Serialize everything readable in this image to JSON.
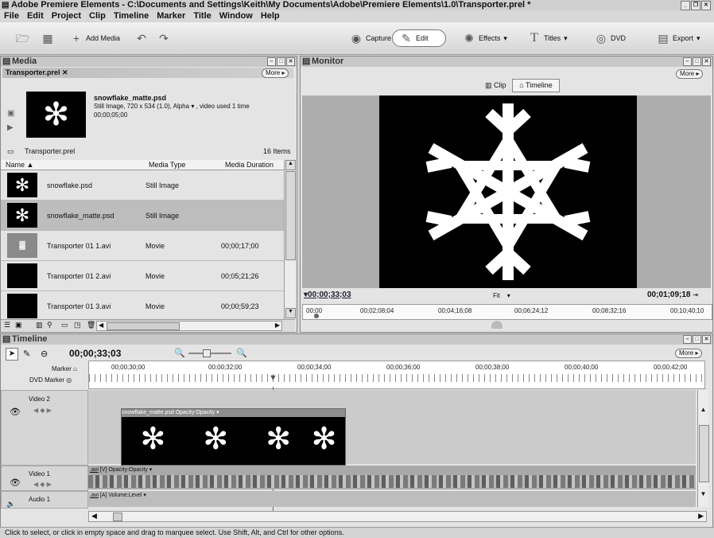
{
  "window": {
    "title": "Adobe Premiere Elements - C:\\Documents and Settings\\Keith\\My Documents\\Adobe\\Premiere Elements\\1.0\\Transporter.prel *"
  },
  "menu": [
    "File",
    "Edit",
    "Project",
    "Clip",
    "Timeline",
    "Marker",
    "Title",
    "Window",
    "Help"
  ],
  "toolbar": {
    "add_media": "Add Media",
    "capture": "Capture",
    "edit": "Edit",
    "effects": "Effects",
    "titles": "Titles",
    "dvd": "DVD",
    "export": "Export"
  },
  "media": {
    "panel_title": "Media",
    "tab_label": "Transporter.prel",
    "more": "More",
    "preview_name": "snowflake_matte.psd",
    "preview_info1": "Still Image, 720 x 534 (1.0), Alpha",
    "preview_info1b": ", video used 1 time",
    "preview_info2": "00;00;05;00",
    "bin_name": "Transporter.prel",
    "item_count": "16 Items",
    "columns": {
      "name": "Name",
      "type": "Media Type",
      "duration": "Media Duration"
    },
    "rows": [
      {
        "name": "snowflake.psd",
        "type": "Still Image",
        "duration": ""
      },
      {
        "name": "snowflake_matte.psd",
        "type": "Still Image",
        "duration": ""
      },
      {
        "name": "Transporter 01 1.avi",
        "type": "Movie",
        "duration": "00;00;17;00"
      },
      {
        "name": "Transporter 01 2.avi",
        "type": "Movie",
        "duration": "00;05;21;26"
      },
      {
        "name": "Transporter 01 3.avi",
        "type": "Movie",
        "duration": "00;00;59;23"
      }
    ]
  },
  "monitor": {
    "panel_title": "Monitor",
    "more": "More",
    "clip_tab": "Clip",
    "timeline_tab": "Timeline",
    "current_time": "00;00;33;03",
    "fit": "Fit",
    "duration": "00;01;09;18",
    "ruler": [
      "00;00",
      "00;02;08;04",
      "00;04;16;08",
      "00;06;24;12",
      "00;08;32;16",
      "00;10;40;10"
    ]
  },
  "timeline": {
    "panel_title": "Timeline",
    "more": "More",
    "current_time": "00;00;33;03",
    "marker_label": "Marker",
    "dvd_marker_label": "DVD Marker",
    "ruler": [
      "00;00;30;00",
      "00;00;32;00",
      "00;00;34;00",
      "00;00;36;00",
      "00;00;38;00",
      "00;00;40;00",
      "00;00;42;00"
    ],
    "tracks": {
      "video2": "Video 2",
      "video1": "Video 1",
      "audio1": "Audio 1"
    },
    "video2_clip": "snowflake_matte.psd",
    "video2_fx": "Opacity:Opacity",
    "video1_clip": ".avi",
    "video1_fx": "[V]  Opacity:Opacity",
    "audio1_clip": ".avi",
    "audio1_fx": "[A]  Volume:Level"
  },
  "status": "Click to select, or click in empty space and drag to marquee select. Use Shift, Alt, and Ctrl for other options."
}
